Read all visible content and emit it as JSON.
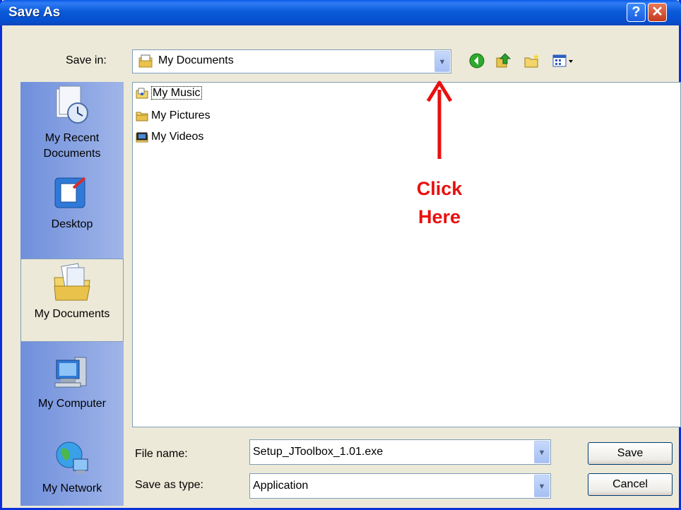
{
  "window": {
    "title": "Save As",
    "help_glyph": "?",
    "close_glyph": "✕"
  },
  "toolbar": {
    "save_in_label": "Save in:",
    "save_in_value": "My Documents",
    "icons": [
      "back-icon",
      "up-folder-icon",
      "new-folder-icon",
      "views-menu-icon"
    ]
  },
  "places": [
    {
      "label_1": "My Recent",
      "label_2": "Documents",
      "icon": "recent-documents-icon"
    },
    {
      "label_1": "Desktop",
      "label_2": "",
      "icon": "desktop-icon"
    },
    {
      "label_1": "My Documents",
      "label_2": "",
      "icon": "my-documents-icon",
      "selected": true
    },
    {
      "label_1": "My Computer",
      "label_2": "",
      "icon": "my-computer-icon"
    },
    {
      "label_1": "My Network",
      "label_2": "",
      "icon": "my-network-icon"
    }
  ],
  "files": [
    {
      "name": "My Music",
      "icon": "music-folder-icon"
    },
    {
      "name": "My Pictures",
      "icon": "folder-icon"
    },
    {
      "name": "My Videos",
      "icon": "video-folder-icon"
    }
  ],
  "annotation": {
    "line1": "Click",
    "line2": "Here",
    "color": "#e81010"
  },
  "form": {
    "file_name_label": "File name:",
    "file_name_value": "Setup_JToolbox_1.01.exe",
    "type_label": "Save as type:",
    "type_value": "Application"
  },
  "buttons": {
    "save": "Save",
    "cancel": "Cancel"
  },
  "colors": {
    "title_bar": "#0b5bd9",
    "dialog_bg": "#ece9d8",
    "border": "#0831d9"
  }
}
